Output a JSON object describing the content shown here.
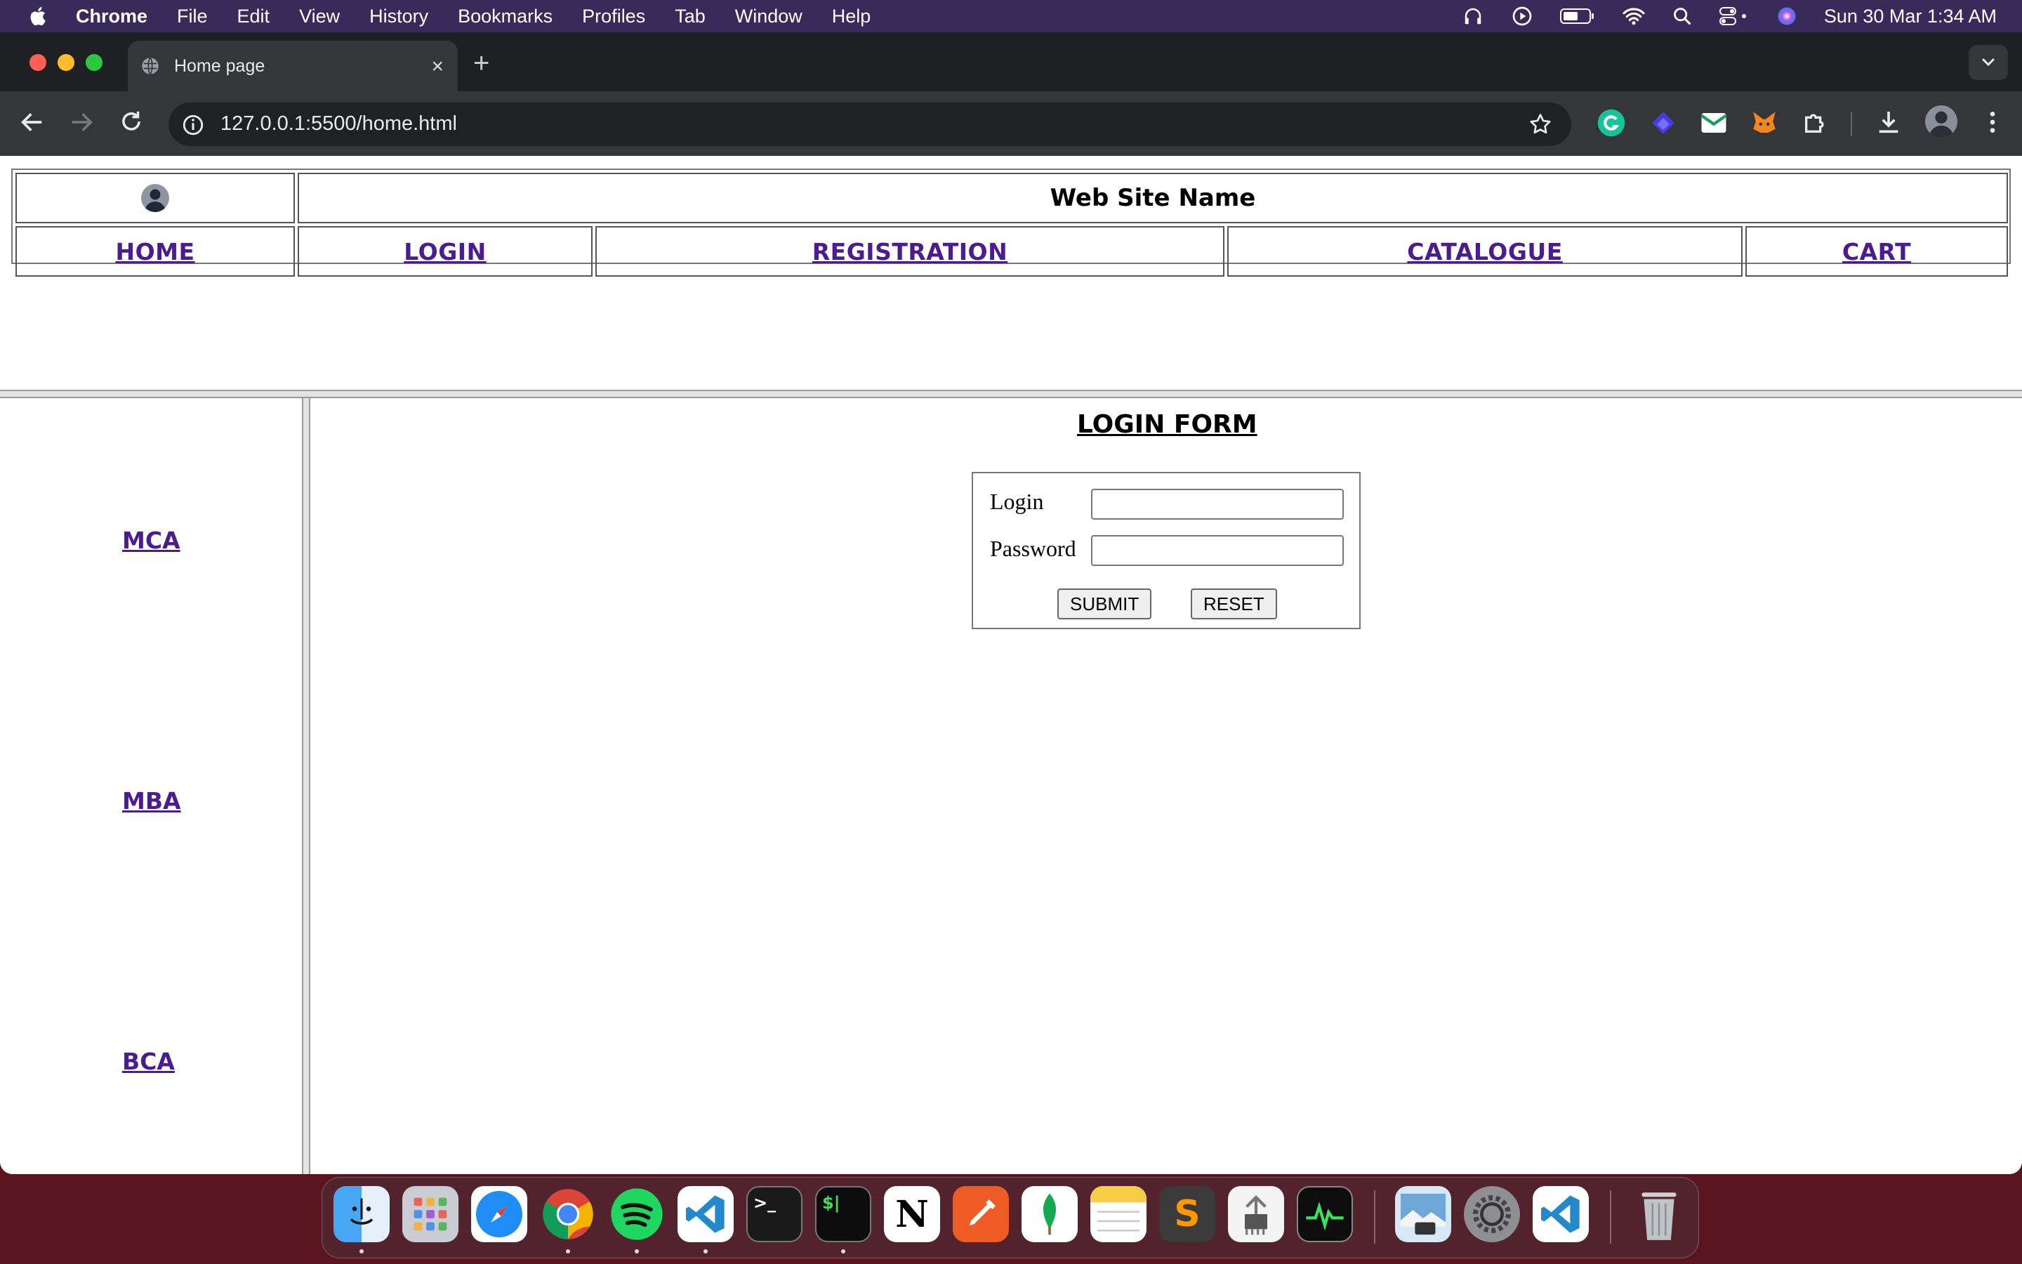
{
  "menubar": {
    "app_name": "Chrome",
    "items": [
      "File",
      "Edit",
      "View",
      "History",
      "Bookmarks",
      "Profiles",
      "Tab",
      "Window",
      "Help"
    ],
    "clock": "Sun 30 Mar  1:34 AM"
  },
  "browser": {
    "tab_title": "Home page",
    "tab_close": "×",
    "new_tab": "+",
    "url": "127.0.0.1:5500/home.html"
  },
  "page": {
    "site_name": "Web Site Name",
    "nav": [
      "HOME",
      "LOGIN",
      "REGISTRATION",
      "CATALOGUE",
      "CART"
    ],
    "sidebar": [
      "MCA",
      "MBA",
      "BCA"
    ],
    "form": {
      "title": "LOGIN FORM",
      "login_label": "Login",
      "password_label": "Password",
      "login_value": "",
      "password_value": "",
      "submit_label": "SUBMIT",
      "reset_label": "RESET"
    }
  },
  "dock": {
    "apps": [
      "finder",
      "launchpad",
      "safari",
      "chrome",
      "spotify",
      "vscode",
      "terminal",
      "iterm",
      "notion",
      "postman",
      "mongodb-compass",
      "notes",
      "sublime-text",
      "system-information",
      "activity-monitor",
      "preview",
      "system-settings",
      "vscode-alt",
      "trash"
    ],
    "notion_glyph": "N",
    "terminal_glyph": ">_",
    "iterm_glyph": "$|",
    "sublime_glyph": "S"
  },
  "colors": {
    "link": "#4b1b91",
    "menubar_bg": "#3a2a5a",
    "desktop_bg": "#5a1420"
  }
}
